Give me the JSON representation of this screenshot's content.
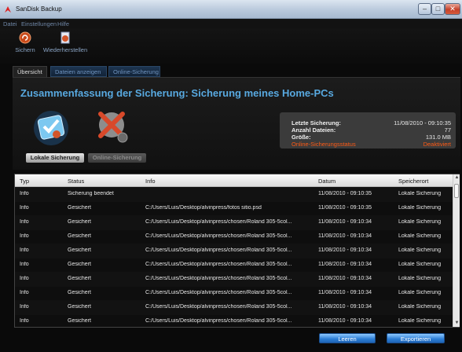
{
  "window": {
    "title": "SanDisk Backup",
    "controls": {
      "minimize": "–",
      "maximize": "□",
      "close": "✕"
    }
  },
  "menu": [
    "Datei",
    "Einstellungen",
    "Hilfe"
  ],
  "toolbar": {
    "backup_label": "Sichern",
    "restore_label": "Wiederherstellen"
  },
  "tabs": [
    "Übersicht",
    "Dateien anzeigen",
    "Online-Sicherung"
  ],
  "summary": {
    "heading": "Zusammenfassung der Sicherung: Sicherung meines Home-PCs",
    "local_button": "Lokale Sicherung",
    "online_button": "Online-Sicherung",
    "info": {
      "last_backup_label": "Letzte Sicherung:",
      "last_backup_value": "11/08/2010 - 09:10:35",
      "file_count_label": "Anzahl Dateien:",
      "file_count_value": "77",
      "size_label": "Größe:",
      "size_value": "131.0 MB",
      "online_status_link": "Online-Sicherungsstatus",
      "online_status_value": "Deaktiviert"
    }
  },
  "log_table": {
    "columns": [
      "Typ",
      "Status",
      "Info",
      "Datum",
      "Speicherort"
    ],
    "rows": [
      {
        "typ": "Info",
        "status": "Sicherung beendet",
        "info": "",
        "datum": "11/08/2010 - 09:10:35",
        "ort": "Lokale Sicherung"
      },
      {
        "typ": "Info",
        "status": "Gesichert",
        "info": "C:/Users/Luis/Desktop/alvinpress/fotos sitio.psd",
        "datum": "11/08/2010 - 09:10:35",
        "ort": "Lokale Sicherung"
      },
      {
        "typ": "Info",
        "status": "Gesichert",
        "info": "C:/Users/Luis/Desktop/alvinpress/chosen/Roland 305-5col...",
        "datum": "11/08/2010 - 09:10:34",
        "ort": "Lokale Sicherung"
      },
      {
        "typ": "Info",
        "status": "Gesichert",
        "info": "C:/Users/Luis/Desktop/alvinpress/chosen/Roland 305-5col...",
        "datum": "11/08/2010 - 09:10:34",
        "ort": "Lokale Sicherung"
      },
      {
        "typ": "Info",
        "status": "Gesichert",
        "info": "C:/Users/Luis/Desktop/alvinpress/chosen/Roland 305-5col...",
        "datum": "11/08/2010 - 09:10:34",
        "ort": "Lokale Sicherung"
      },
      {
        "typ": "Info",
        "status": "Gesichert",
        "info": "C:/Users/Luis/Desktop/alvinpress/chosen/Roland 305-5col...",
        "datum": "11/08/2010 - 09:10:34",
        "ort": "Lokale Sicherung"
      },
      {
        "typ": "Info",
        "status": "Gesichert",
        "info": "C:/Users/Luis/Desktop/alvinpress/chosen/Roland 305-5col...",
        "datum": "11/08/2010 - 09:10:34",
        "ort": "Lokale Sicherung"
      },
      {
        "typ": "Info",
        "status": "Gesichert",
        "info": "C:/Users/Luis/Desktop/alvinpress/chosen/Roland 305-5col...",
        "datum": "11/08/2010 - 09:10:34",
        "ort": "Lokale Sicherung"
      },
      {
        "typ": "Info",
        "status": "Gesichert",
        "info": "C:/Users/Luis/Desktop/alvinpress/chosen/Roland 305-5col...",
        "datum": "11/08/2010 - 09:10:34",
        "ort": "Lokale Sicherung"
      },
      {
        "typ": "Info",
        "status": "Gesichert",
        "info": "C:/Users/Luis/Desktop/alvinpress/chosen/Roland 305-5col...",
        "datum": "11/08/2010 - 09:10:34",
        "ort": "Lokale Sicherung"
      }
    ]
  },
  "actions": {
    "clear_label": "Leeren",
    "export_label": "Exportieren"
  },
  "colors": {
    "accent": "#58a9e0",
    "link": "#ff5a14",
    "button_blue": "#2a7cd4"
  }
}
